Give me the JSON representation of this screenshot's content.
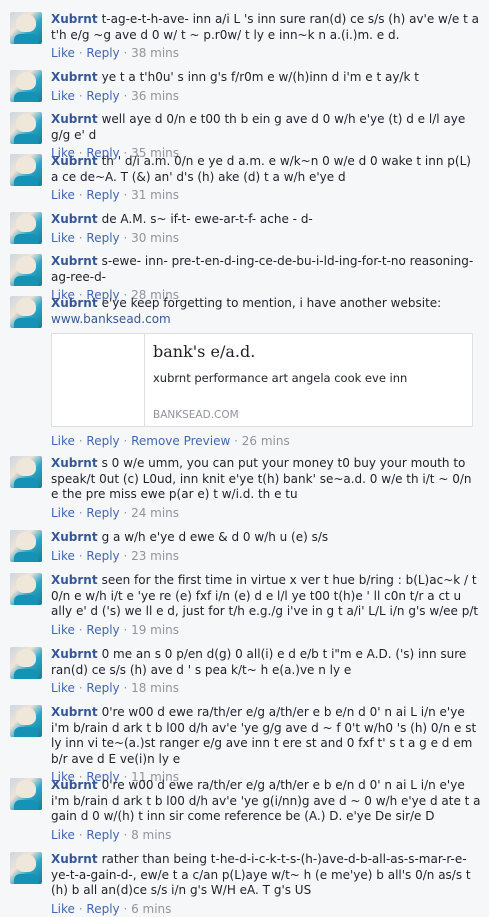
{
  "comments": [
    {
      "author": "Xubrnt",
      "text": "t-ag-e-t-h-ave- inn a/i L 's inn sure ran(d) ce s/s (h) av'e w/e t a t'h e/g ~g ave d 0 w/ t ~ p.r0w/ t ly e inn~k n a.(i.)m. e d.",
      "like": "Like",
      "reply": "Reply",
      "time": "38 mins"
    },
    {
      "author": "Xubrnt",
      "text": "ye t a t'h0u' s inn g's f/r0m e w/(h)inn d i'm e t ay/k t",
      "like": "Like",
      "reply": "Reply",
      "time": "36 mins"
    },
    {
      "author": "Xubrnt",
      "text": "well aye d 0/n e t00 th b ein g ave d 0 w/h e'ye (t) d e l/l aye g/g e' d",
      "like": "Like",
      "reply": "Reply",
      "time": "35 mins"
    },
    {
      "author": "Xubrnt",
      "text": "th ' d/i a.m. 0/n e ye d a.m. e w/k~n 0 w/e d 0 wake t inn p(L) a ce de~A. T (&) an' d's (h) ake (d) t a w/h e'ye d",
      "like": "Like",
      "reply": "Reply",
      "time": "31 mins"
    },
    {
      "author": "Xubrnt",
      "text": "de A.M. s~ if-t- ewe-ar-t-f- ache - d-",
      "like": "Like",
      "reply": "Reply",
      "time": "30 mins"
    },
    {
      "author": "Xubrnt",
      "text": "s-ewe- inn- pre-t-en-d-ing-ce-de-bu-i-ld-ing-for-t-no reasoning-ag-ree-d-",
      "like": "Like",
      "reply": "Reply",
      "time": "28 mins"
    },
    {
      "author": "Xubrnt",
      "text": "e'ye keep forgetting to mention, i have another website:",
      "url": "www.banksead.com",
      "preview": {
        "title": "bank's e/a.d.",
        "desc": "xubrnt performance art angela cook eve inn",
        "domain": "BANKSEAD.COM"
      },
      "like": "Like",
      "reply": "Reply",
      "remove": "Remove Preview",
      "time": "26 mins"
    },
    {
      "author": "Xubrnt",
      "text": "s 0 w/e umm, you can put your money t0 buy your mouth to speak/t 0ut (c) L0ud, inn knit e'ye t(h) bank' se~a.d. 0 w/e th i/t ~ 0/n e the pre miss ewe p(ar e) t w/i.d. th e tu",
      "like": "Like",
      "reply": "Reply",
      "time": "24 mins"
    },
    {
      "author": "Xubrnt",
      "text": "g a w/h e'ye d ewe & d 0 w/h u (e) s/s",
      "like": "Like",
      "reply": "Reply",
      "time": "23 mins"
    },
    {
      "author": "Xubrnt",
      "text": "seen for the first time in virtue x ver t hue b/ring : b(L)ac~k / t 0/n e w/h i/t e 'ye re (e) fxf i/n (e) d e l/l ye t00 t(h)e ' ll c0n t/r a ct u ally e' d ('s) we ll e d, just for t/h e.g./g i've in g t a/i' L/L i/n g's w/ee p/t",
      "like": "Like",
      "reply": "Reply",
      "time": "19 mins"
    },
    {
      "author": "Xubrnt",
      "text": "0 me an s 0 p/en d(g) 0 all(i) e d e/b t i\"m e A.D. ('s) inn sure ran(d) ce s/s (h) ave d ' s pea k/t~ h e(a.)ve n ly e",
      "like": "Like",
      "reply": "Reply",
      "time": "18 mins"
    },
    {
      "author": "Xubrnt",
      "text": "0're w00 d ewe ra/th/er e/g a/th/er e b e/n d 0' n ai L i/n e'ye i'm b/rain d ark t b l00 d/h av'e 'ye g/g ave d ~ f 0't w/h0 's (h) 0/n e st ly inn vi te~(a.)st ranger e/g ave inn t ere st and 0 fxf t' s t a g e d em b/r ave d E ve(i)n ly e",
      "like": "Like",
      "reply": "Reply",
      "time": "11 mins"
    },
    {
      "author": "Xubrnt",
      "text": "0're w00 d ewe ra/th/er e/g a/th/er e b e/n d 0' n ai L i/n e'ye i'm b/rain d ark t b l00 d/h av'e 'ye g(i/nn)g ave d ~ 0 w/h e'ye d ate t a gain d 0 w/(h) t inn sir come reference be (A.) D. e'ye De sir/e D",
      "like": "Like",
      "reply": "Reply",
      "time": "8 mins"
    },
    {
      "author": "Xubrnt",
      "text": "rather than being t-he-d-i-c-k-t-s-(h-)ave-d-b-all-as-s-mar-r-e-ye-t-a-gain-d-, ew/e t a c/an p(L)aye w/t~ h (e me'ye) b all's 0/n as/s t (h) b all an(d)ce s/s i/n g's W/H eA. T g's US",
      "like": "Like",
      "reply": "Reply",
      "time": "6 mins"
    }
  ]
}
